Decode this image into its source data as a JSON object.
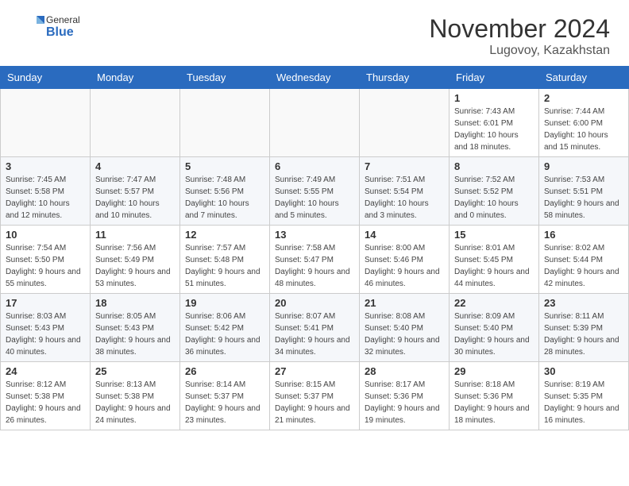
{
  "header": {
    "logo_general": "General",
    "logo_blue": "Blue",
    "month_title": "November 2024",
    "location": "Lugovoy, Kazakhstan"
  },
  "days_of_week": [
    "Sunday",
    "Monday",
    "Tuesday",
    "Wednesday",
    "Thursday",
    "Friday",
    "Saturday"
  ],
  "weeks": [
    [
      {
        "day": "",
        "info": ""
      },
      {
        "day": "",
        "info": ""
      },
      {
        "day": "",
        "info": ""
      },
      {
        "day": "",
        "info": ""
      },
      {
        "day": "",
        "info": ""
      },
      {
        "day": "1",
        "info": "Sunrise: 7:43 AM\nSunset: 6:01 PM\nDaylight: 10 hours and 18 minutes."
      },
      {
        "day": "2",
        "info": "Sunrise: 7:44 AM\nSunset: 6:00 PM\nDaylight: 10 hours and 15 minutes."
      }
    ],
    [
      {
        "day": "3",
        "info": "Sunrise: 7:45 AM\nSunset: 5:58 PM\nDaylight: 10 hours and 12 minutes."
      },
      {
        "day": "4",
        "info": "Sunrise: 7:47 AM\nSunset: 5:57 PM\nDaylight: 10 hours and 10 minutes."
      },
      {
        "day": "5",
        "info": "Sunrise: 7:48 AM\nSunset: 5:56 PM\nDaylight: 10 hours and 7 minutes."
      },
      {
        "day": "6",
        "info": "Sunrise: 7:49 AM\nSunset: 5:55 PM\nDaylight: 10 hours and 5 minutes."
      },
      {
        "day": "7",
        "info": "Sunrise: 7:51 AM\nSunset: 5:54 PM\nDaylight: 10 hours and 3 minutes."
      },
      {
        "day": "8",
        "info": "Sunrise: 7:52 AM\nSunset: 5:52 PM\nDaylight: 10 hours and 0 minutes."
      },
      {
        "day": "9",
        "info": "Sunrise: 7:53 AM\nSunset: 5:51 PM\nDaylight: 9 hours and 58 minutes."
      }
    ],
    [
      {
        "day": "10",
        "info": "Sunrise: 7:54 AM\nSunset: 5:50 PM\nDaylight: 9 hours and 55 minutes."
      },
      {
        "day": "11",
        "info": "Sunrise: 7:56 AM\nSunset: 5:49 PM\nDaylight: 9 hours and 53 minutes."
      },
      {
        "day": "12",
        "info": "Sunrise: 7:57 AM\nSunset: 5:48 PM\nDaylight: 9 hours and 51 minutes."
      },
      {
        "day": "13",
        "info": "Sunrise: 7:58 AM\nSunset: 5:47 PM\nDaylight: 9 hours and 48 minutes."
      },
      {
        "day": "14",
        "info": "Sunrise: 8:00 AM\nSunset: 5:46 PM\nDaylight: 9 hours and 46 minutes."
      },
      {
        "day": "15",
        "info": "Sunrise: 8:01 AM\nSunset: 5:45 PM\nDaylight: 9 hours and 44 minutes."
      },
      {
        "day": "16",
        "info": "Sunrise: 8:02 AM\nSunset: 5:44 PM\nDaylight: 9 hours and 42 minutes."
      }
    ],
    [
      {
        "day": "17",
        "info": "Sunrise: 8:03 AM\nSunset: 5:43 PM\nDaylight: 9 hours and 40 minutes."
      },
      {
        "day": "18",
        "info": "Sunrise: 8:05 AM\nSunset: 5:43 PM\nDaylight: 9 hours and 38 minutes."
      },
      {
        "day": "19",
        "info": "Sunrise: 8:06 AM\nSunset: 5:42 PM\nDaylight: 9 hours and 36 minutes."
      },
      {
        "day": "20",
        "info": "Sunrise: 8:07 AM\nSunset: 5:41 PM\nDaylight: 9 hours and 34 minutes."
      },
      {
        "day": "21",
        "info": "Sunrise: 8:08 AM\nSunset: 5:40 PM\nDaylight: 9 hours and 32 minutes."
      },
      {
        "day": "22",
        "info": "Sunrise: 8:09 AM\nSunset: 5:40 PM\nDaylight: 9 hours and 30 minutes."
      },
      {
        "day": "23",
        "info": "Sunrise: 8:11 AM\nSunset: 5:39 PM\nDaylight: 9 hours and 28 minutes."
      }
    ],
    [
      {
        "day": "24",
        "info": "Sunrise: 8:12 AM\nSunset: 5:38 PM\nDaylight: 9 hours and 26 minutes."
      },
      {
        "day": "25",
        "info": "Sunrise: 8:13 AM\nSunset: 5:38 PM\nDaylight: 9 hours and 24 minutes."
      },
      {
        "day": "26",
        "info": "Sunrise: 8:14 AM\nSunset: 5:37 PM\nDaylight: 9 hours and 23 minutes."
      },
      {
        "day": "27",
        "info": "Sunrise: 8:15 AM\nSunset: 5:37 PM\nDaylight: 9 hours and 21 minutes."
      },
      {
        "day": "28",
        "info": "Sunrise: 8:17 AM\nSunset: 5:36 PM\nDaylight: 9 hours and 19 minutes."
      },
      {
        "day": "29",
        "info": "Sunrise: 8:18 AM\nSunset: 5:36 PM\nDaylight: 9 hours and 18 minutes."
      },
      {
        "day": "30",
        "info": "Sunrise: 8:19 AM\nSunset: 5:35 PM\nDaylight: 9 hours and 16 minutes."
      }
    ]
  ]
}
